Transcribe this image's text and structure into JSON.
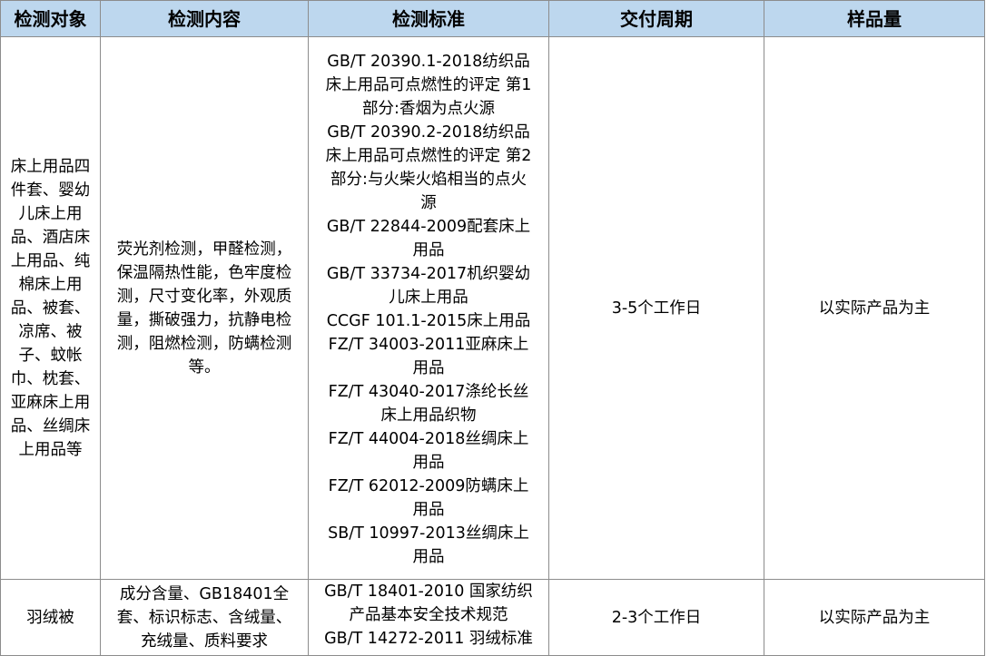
{
  "headers": [
    "检测对象",
    "检测内容",
    "检测标准",
    "交付周期",
    "样品量"
  ],
  "rows": [
    {
      "object_lines": [
        "床上用品四",
        "件套、婴幼",
        "儿床上用",
        "品、酒店床",
        "上用品、纯",
        "棉床上用",
        "品、被套、",
        "凉席、被",
        "子、蚊帐",
        "巾、枕套、",
        "亚麻床上用",
        "品、丝绸床",
        "上用品等"
      ],
      "content_lines": [
        "荧光剂检测，甲醛检测，",
        "保温隔热性能，色牢度检",
        "测，尺寸变化率，外观质",
        "量，撕破强力，抗静电检",
        "测，阻燃检测，防螨检测",
        "等。"
      ],
      "standard_lines": [
        "GB/T 20390.1-2018纺织品",
        "床上用品可点燃性的评定 第1",
        "部分:香烟为点火源",
        "GB/T 20390.2-2018纺织品",
        "床上用品可点燃性的评定 第2",
        "部分:与火柴火焰相当的点火",
        "源",
        "GB/T 22844-2009配套床上",
        "用品",
        "GB/T 33734-2017机织婴幼",
        "儿床上用品",
        "CCGF 101.1-2015床上用品",
        "FZ/T 34003-2011亚麻床上",
        "用品",
        "FZ/T 43040-2017涤纶长丝",
        "床上用品织物",
        "FZ/T 44004-2018丝绸床上",
        "用品",
        "FZ/T 62012-2009防螨床上",
        "用品",
        "SB/T 10997-2013丝绸床上",
        "用品"
      ],
      "cycle": "3-5个工作日",
      "sample": "以实际产品为主"
    },
    {
      "object_lines": [
        "羽绒被"
      ],
      "content_lines": [
        "成分含量、GB18401全",
        "套、标识标志、含绒量、",
        "充绒量、质料要求"
      ],
      "standard_lines": [
        "GB/T 18401-2010 国家纺织",
        "产品基本安全技术规范",
        "GB/T 14272-2011 羽绒标准"
      ],
      "cycle": "2-3个工作日",
      "sample": "以实际产品为主"
    }
  ]
}
